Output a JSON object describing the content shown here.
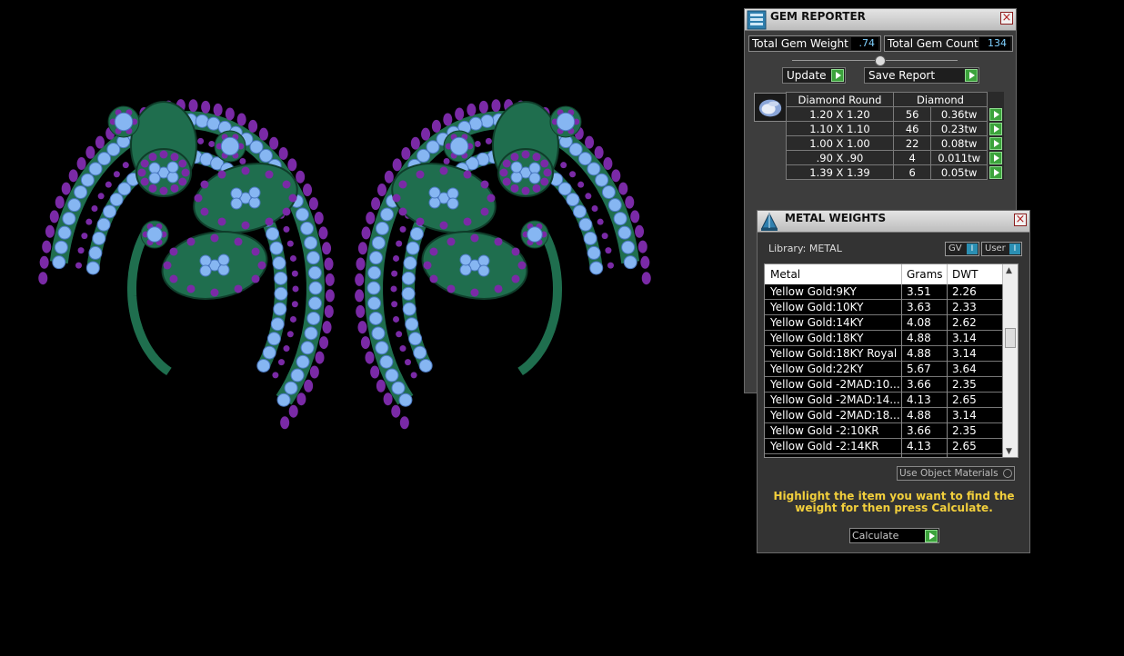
{
  "gem_reporter": {
    "title": "GEM REPORTER",
    "close": "×",
    "total_weight_label": "Total Gem Weight",
    "total_weight_value": ".74",
    "total_count_label": "Total Gem Count",
    "total_count_value": "134",
    "update_label": "Update",
    "save_report_label": "Save Report",
    "table": {
      "shape_header": "Diamond Round",
      "material_header": "Diamond",
      "rows": [
        {
          "size": "1.20 X 1.20",
          "count": "56",
          "weight": "0.36tw"
        },
        {
          "size": "1.10 X 1.10",
          "count": "46",
          "weight": "0.23tw"
        },
        {
          "size": "1.00 X 1.00",
          "count": "22",
          "weight": "0.08tw"
        },
        {
          "size": ".90 X .90",
          "count": "4",
          "weight": "0.011tw"
        },
        {
          "size": "1.39 X 1.39",
          "count": "6",
          "weight": "0.05tw"
        }
      ]
    }
  },
  "metal_weights": {
    "title": "METAL WEIGHTS",
    "close": "×",
    "library_label": "Library: METAL",
    "gv_label": "GV",
    "user_label": "User",
    "toggle_glyph": "I",
    "columns": [
      "Metal",
      "Grams",
      "DWT"
    ],
    "rows": [
      {
        "metal": "Yellow Gold:9KY",
        "grams": "3.51",
        "dwt": "2.26"
      },
      {
        "metal": "Yellow Gold:10KY",
        "grams": "3.63",
        "dwt": "2.33"
      },
      {
        "metal": "Yellow Gold:14KY",
        "grams": "4.08",
        "dwt": "2.62"
      },
      {
        "metal": "Yellow Gold:18KY",
        "grams": "4.88",
        "dwt": "3.14"
      },
      {
        "metal": "Yellow Gold:18KY Royal",
        "grams": "4.88",
        "dwt": "3.14"
      },
      {
        "metal": "Yellow Gold:22KY",
        "grams": "5.67",
        "dwt": "3.64"
      },
      {
        "metal": "Yellow Gold -2MAD:10...",
        "grams": "3.66",
        "dwt": "2.35"
      },
      {
        "metal": "Yellow Gold -2MAD:14...",
        "grams": "4.13",
        "dwt": "2.65"
      },
      {
        "metal": "Yellow Gold -2MAD:18...",
        "grams": "4.88",
        "dwt": "3.14"
      },
      {
        "metal": "Yellow Gold -2:10KR",
        "grams": "3.66",
        "dwt": "2.35"
      },
      {
        "metal": "Yellow Gold -2:14KR",
        "grams": "4.13",
        "dwt": "2.65"
      }
    ],
    "use_object_label": "Use Object Materials",
    "instruction": "Highlight the item you want to find the weight for then press Calculate.",
    "calculate_label": "Calculate"
  },
  "colors": {
    "metal_green": "#1f6e4e",
    "gem_blue": "#86b6f2",
    "gem_purple": "#7a2aa6",
    "instruction_yellow": "#f2cf3c"
  }
}
